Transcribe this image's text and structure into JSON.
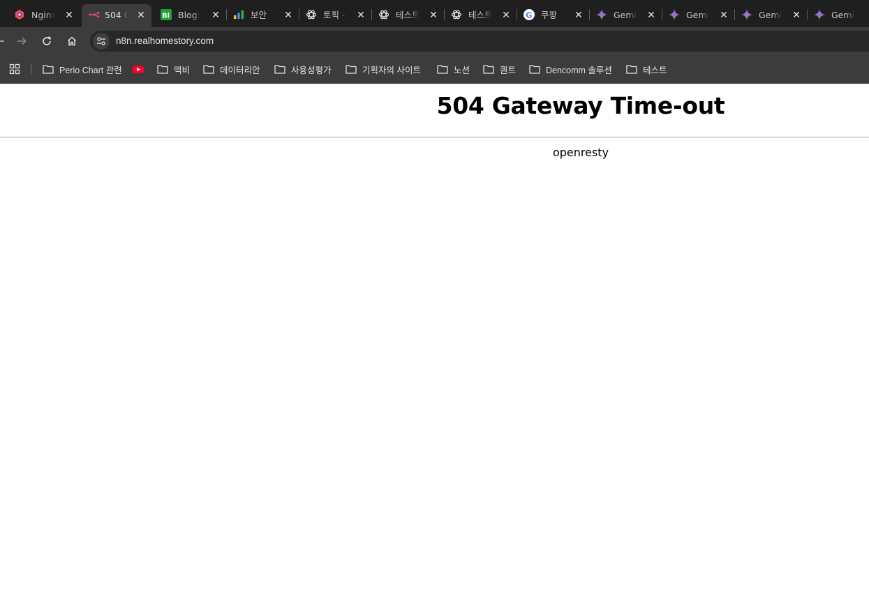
{
  "tabs": [
    {
      "title": "Nginx",
      "icon": "nginx-proxy-icon",
      "active": false
    },
    {
      "title": "504 G",
      "icon": "n8n-icon",
      "active": true
    },
    {
      "title": "Blog:",
      "icon": "blogger-icon",
      "active": false
    },
    {
      "title": "보안 ",
      "icon": "analytics-icon",
      "active": false
    },
    {
      "title": "토픽 -",
      "icon": "chatgpt-icon",
      "active": false
    },
    {
      "title": "테스트",
      "icon": "chatgpt-icon",
      "active": false
    },
    {
      "title": "테스트",
      "icon": "chatgpt-icon",
      "active": false
    },
    {
      "title": "쿠팡 ",
      "icon": "google-icon",
      "active": false
    },
    {
      "title": "Gemir",
      "icon": "gemini-icon",
      "active": false
    },
    {
      "title": "Gemir",
      "icon": "gemini-icon",
      "active": false
    },
    {
      "title": "Gemir",
      "icon": "gemini-icon",
      "active": false
    },
    {
      "title": "Gemir",
      "icon": "gemini-icon",
      "active": false
    }
  ],
  "address_bar": {
    "url": "n8n.realhomestory.com"
  },
  "bookmarks": [
    {
      "label": "Perio Chart 관련",
      "icon": "folder-icon"
    },
    {
      "label": "",
      "icon": "youtube-icon"
    },
    {
      "label": "맥비",
      "icon": "folder-icon"
    },
    {
      "label": "데이터리안",
      "icon": "folder-icon"
    },
    {
      "label": "사용성평가",
      "icon": "folder-icon"
    },
    {
      "label": "기획자의 사이트",
      "icon": "folder-icon"
    },
    {
      "label": "노션",
      "icon": "folder-icon"
    },
    {
      "label": "퀀트",
      "icon": "folder-icon"
    },
    {
      "label": "Dencomm 솔루션",
      "icon": "folder-icon"
    },
    {
      "label": "테스트",
      "icon": "folder-icon"
    }
  ],
  "page": {
    "heading": "504 Gateway Time-out",
    "server": "openresty"
  },
  "colors": {
    "tabstrip_bg": "#1f1f1f",
    "toolbar_bg": "#3c3c3c",
    "omnibox_bg": "#282828",
    "page_bg": "#ffffff"
  }
}
